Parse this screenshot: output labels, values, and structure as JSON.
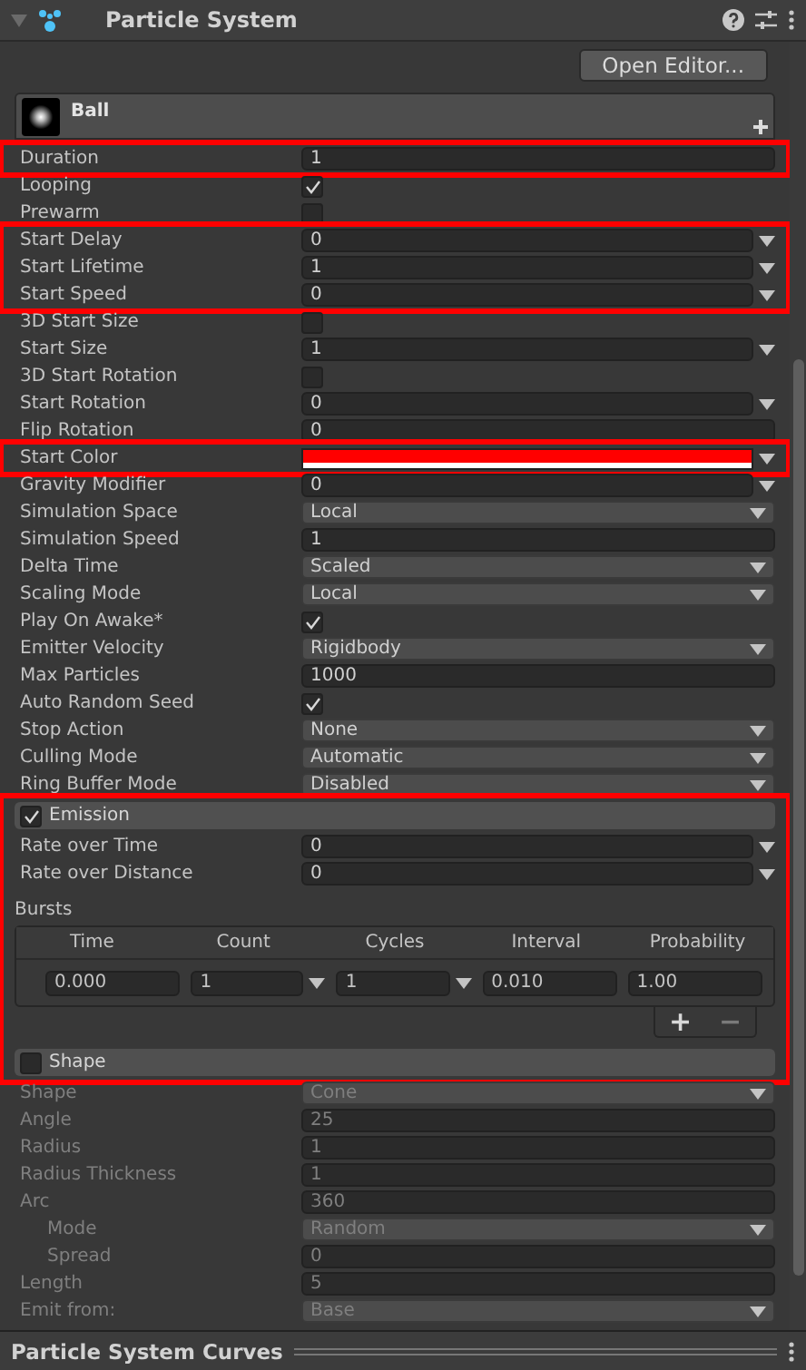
{
  "window": {
    "title": "Particle System"
  },
  "open_editor": "Open Editor...",
  "main_module": {
    "name": "Ball"
  },
  "blocks": [
    {
      "kind": "rows",
      "highlighted": true,
      "rows": [
        {
          "label": "Duration",
          "kind": "float",
          "value": "1"
        }
      ]
    },
    {
      "kind": "rows",
      "highlighted": false,
      "rows": [
        {
          "label": "Looping",
          "kind": "toggle",
          "checked": true
        },
        {
          "label": "Prewarm",
          "kind": "toggle",
          "checked": false
        }
      ]
    },
    {
      "kind": "rows",
      "highlighted": true,
      "rows": [
        {
          "label": "Start Delay",
          "kind": "curve",
          "value": "0"
        },
        {
          "label": "Start Lifetime",
          "kind": "curve",
          "value": "1"
        },
        {
          "label": "Start Speed",
          "kind": "curve",
          "value": "0"
        }
      ]
    },
    {
      "kind": "rows",
      "highlighted": false,
      "rows": [
        {
          "label": "3D Start Size",
          "kind": "toggle",
          "checked": false
        },
        {
          "label": "Start Size",
          "kind": "curve",
          "value": "1"
        },
        {
          "label": "3D Start Rotation",
          "kind": "toggle",
          "checked": false
        },
        {
          "label": "Start Rotation",
          "kind": "curve",
          "value": "0"
        },
        {
          "label": "Flip Rotation",
          "kind": "float",
          "value": "0"
        }
      ]
    },
    {
      "kind": "rows",
      "highlighted": true,
      "rows": [
        {
          "label": "Start Color",
          "kind": "color",
          "color": "#ff0000"
        }
      ]
    },
    {
      "kind": "rows",
      "highlighted": false,
      "rows": [
        {
          "label": "Gravity Modifier",
          "kind": "curve",
          "value": "0"
        },
        {
          "label": "Simulation Space",
          "kind": "enum",
          "value": "Local"
        },
        {
          "label": "Simulation Speed",
          "kind": "float",
          "value": "1"
        },
        {
          "label": "Delta Time",
          "kind": "enum",
          "value": "Scaled"
        },
        {
          "label": "Scaling Mode",
          "kind": "enum",
          "value": "Local"
        },
        {
          "label": "Play On Awake*",
          "kind": "toggle",
          "checked": true
        },
        {
          "label": "Emitter Velocity",
          "kind": "enum",
          "value": "Rigidbody"
        },
        {
          "label": "Max Particles",
          "kind": "float",
          "value": "1000"
        },
        {
          "label": "Auto Random Seed",
          "kind": "toggle",
          "checked": true
        },
        {
          "label": "Stop Action",
          "kind": "enum",
          "value": "None"
        },
        {
          "label": "Culling Mode",
          "kind": "enum",
          "value": "Automatic"
        },
        {
          "label": "Ring Buffer Mode",
          "kind": "enum",
          "value": "Disabled"
        }
      ]
    },
    {
      "kind": "module",
      "highlighted": true,
      "title": "Emission",
      "enabled": true,
      "rows": [
        {
          "label": "Rate over Time",
          "kind": "curve",
          "value": "0"
        },
        {
          "label": "Rate over Distance",
          "kind": "curve",
          "value": "0"
        }
      ],
      "bursts": {
        "label": "Bursts",
        "columns": [
          "Time",
          "Count",
          "Cycles",
          "Interval",
          "Probability"
        ],
        "rows": [
          [
            {
              "kind": "float",
              "value": "0.000"
            },
            {
              "kind": "curve",
              "value": "1"
            },
            {
              "kind": "curve",
              "value": "1"
            },
            {
              "kind": "float",
              "value": "0.010"
            },
            {
              "kind": "float",
              "value": "1.00"
            }
          ]
        ],
        "add": "+",
        "remove": "−"
      }
    },
    {
      "kind": "module",
      "highlighted": true,
      "title": "Shape",
      "enabled": false
    },
    {
      "kind": "rows",
      "highlighted": false,
      "disabled": true,
      "rows": [
        {
          "label": "Shape",
          "kind": "enum",
          "value": "Cone"
        },
        {
          "label": "Angle",
          "kind": "float",
          "value": "25"
        },
        {
          "label": "Radius",
          "kind": "float",
          "value": "1"
        },
        {
          "label": "Radius Thickness",
          "kind": "float",
          "value": "1"
        },
        {
          "label": "Arc",
          "kind": "float",
          "value": "360",
          "children": [
            {
              "label": "Mode",
              "kind": "enum",
              "value": "Random"
            },
            {
              "label": "Spread",
              "kind": "float",
              "value": "0"
            }
          ]
        },
        {
          "label": "Length",
          "kind": "float",
          "value": "5"
        },
        {
          "label": "Emit from:",
          "kind": "enum",
          "value": "Base"
        }
      ]
    }
  ],
  "bottom_panel": {
    "title": "Particle System Curves"
  }
}
